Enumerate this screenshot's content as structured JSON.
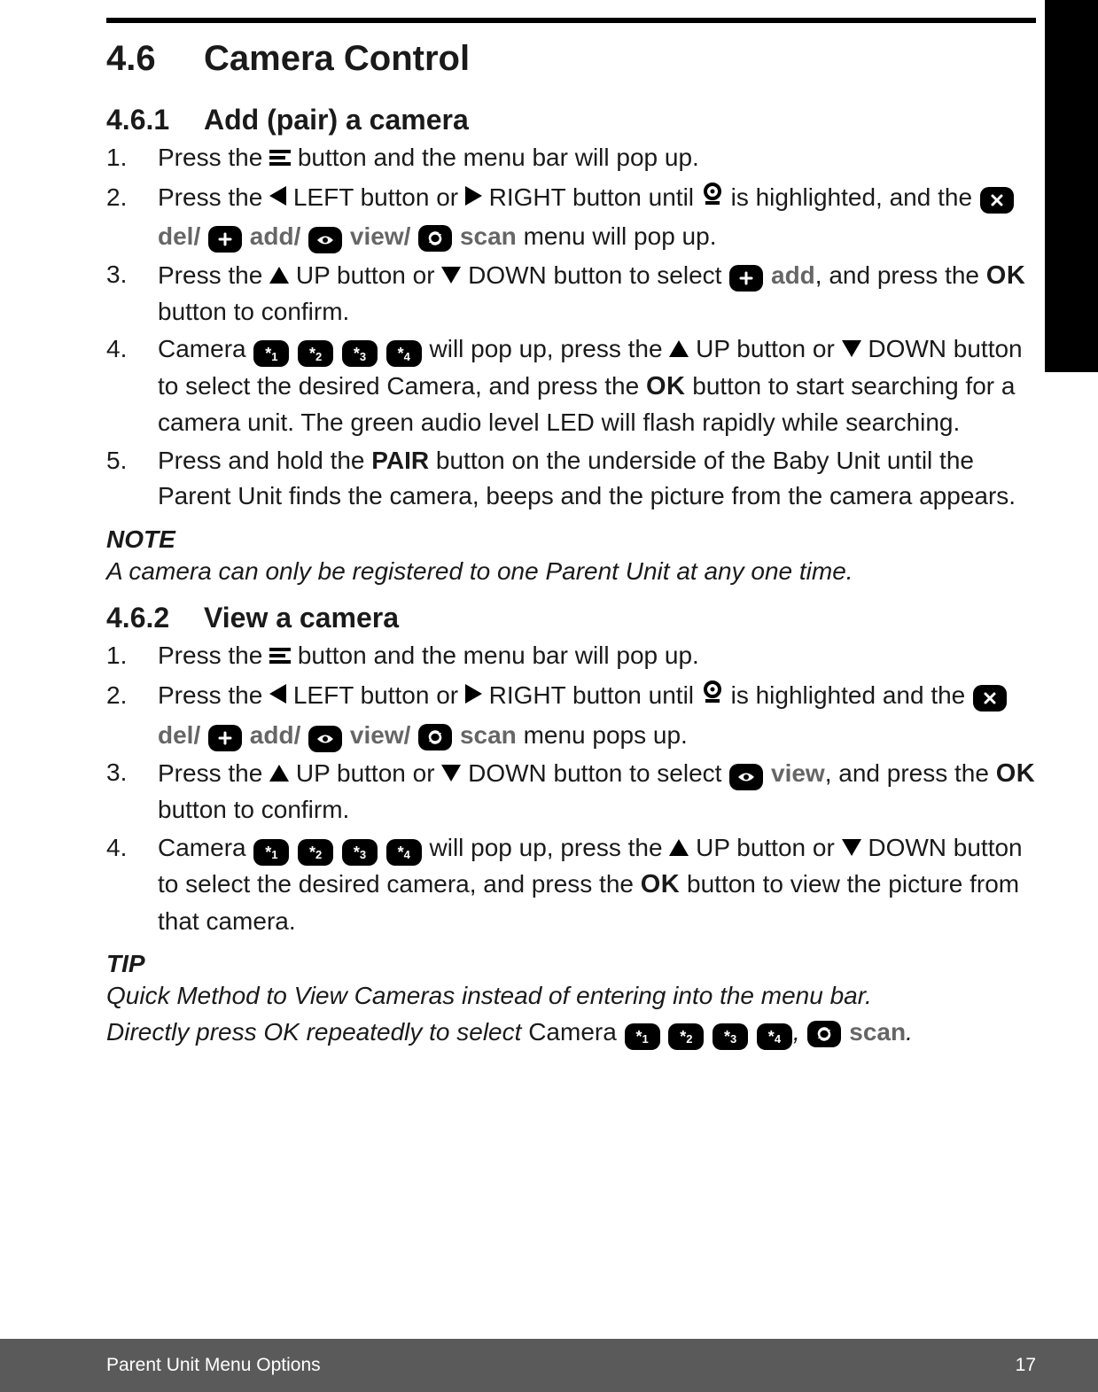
{
  "section": {
    "number": "4.6",
    "title": "Camera Control"
  },
  "sub1": {
    "number": "4.6.1",
    "title": "Add (pair) a camera",
    "steps": {
      "s1a": "Press the ",
      "s1b": " button and the menu bar will pop up.",
      "s2a": "Press the ",
      "s2b": " LEFT button or ",
      "s2c": " RIGHT button until ",
      "s2d": " is highlighted, and the ",
      "s2e": " menu will pop up.",
      "s3a": "Press the ",
      "s3b": " UP button or ",
      "s3c": " DOWN button to select ",
      "s3d": ", and press the ",
      "s3e": " button to confirm.",
      "s4a": "Camera ",
      "s4b": " will pop up, press the ",
      "s4c": " UP button or ",
      "s4d": " DOWN button to select the desired Camera, and press the ",
      "s4e": " button to start searching for a camera unit. The green audio level LED will flash rapidly while searching.",
      "s5a": "Press and hold the ",
      "s5b": "PAIR",
      "s5c": " button on the underside of the Baby Unit until the Parent Unit finds the camera, beeps and the picture from the camera appears."
    }
  },
  "note": {
    "label": "NOTE",
    "body": "A camera can only be registered to one Parent Unit at any one time."
  },
  "sub2": {
    "number": "4.6.2",
    "title": "View a camera",
    "steps": {
      "s1a": "Press the ",
      "s1b": " button and the menu bar will pop up.",
      "s2a": "Press the ",
      "s2b": " LEFT button or ",
      "s2c": " RIGHT button until ",
      "s2d": " is highlighted and the ",
      "s2e": " menu pops up.",
      "s3a": "Press the ",
      "s3b": " UP button or ",
      "s3c": " DOWN button to select ",
      "s3d": ", and press the ",
      "s3e": " button to confirm.",
      "s4a": "Camera ",
      "s4b": " will pop up, press the ",
      "s4c": " UP button or ",
      "s4d": " DOWN button to select the desired camera, and press the ",
      "s4e": " button to view the picture from that camera."
    }
  },
  "tip": {
    "label": "TIP",
    "line1": "Quick Method to View Cameras instead of entering into the menu bar.",
    "line2a": "Directly press OK repeatedly to select ",
    "line2b": "Camera ",
    "line2c": ", ",
    "line2d": "."
  },
  "menu_labels": {
    "del": "del/",
    "add": "add/",
    "view": "view/",
    "scan": "scan",
    "add_only": "add",
    "view_only": "view"
  },
  "ok": "OK",
  "cams": {
    "c1a": "*",
    "c1b": "1",
    "c2a": "*",
    "c2b": "2",
    "c3a": "*",
    "c3b": "3",
    "c4a": "*",
    "c4b": "4"
  },
  "footer": {
    "left": "Parent Unit Menu Options",
    "right": "17"
  }
}
